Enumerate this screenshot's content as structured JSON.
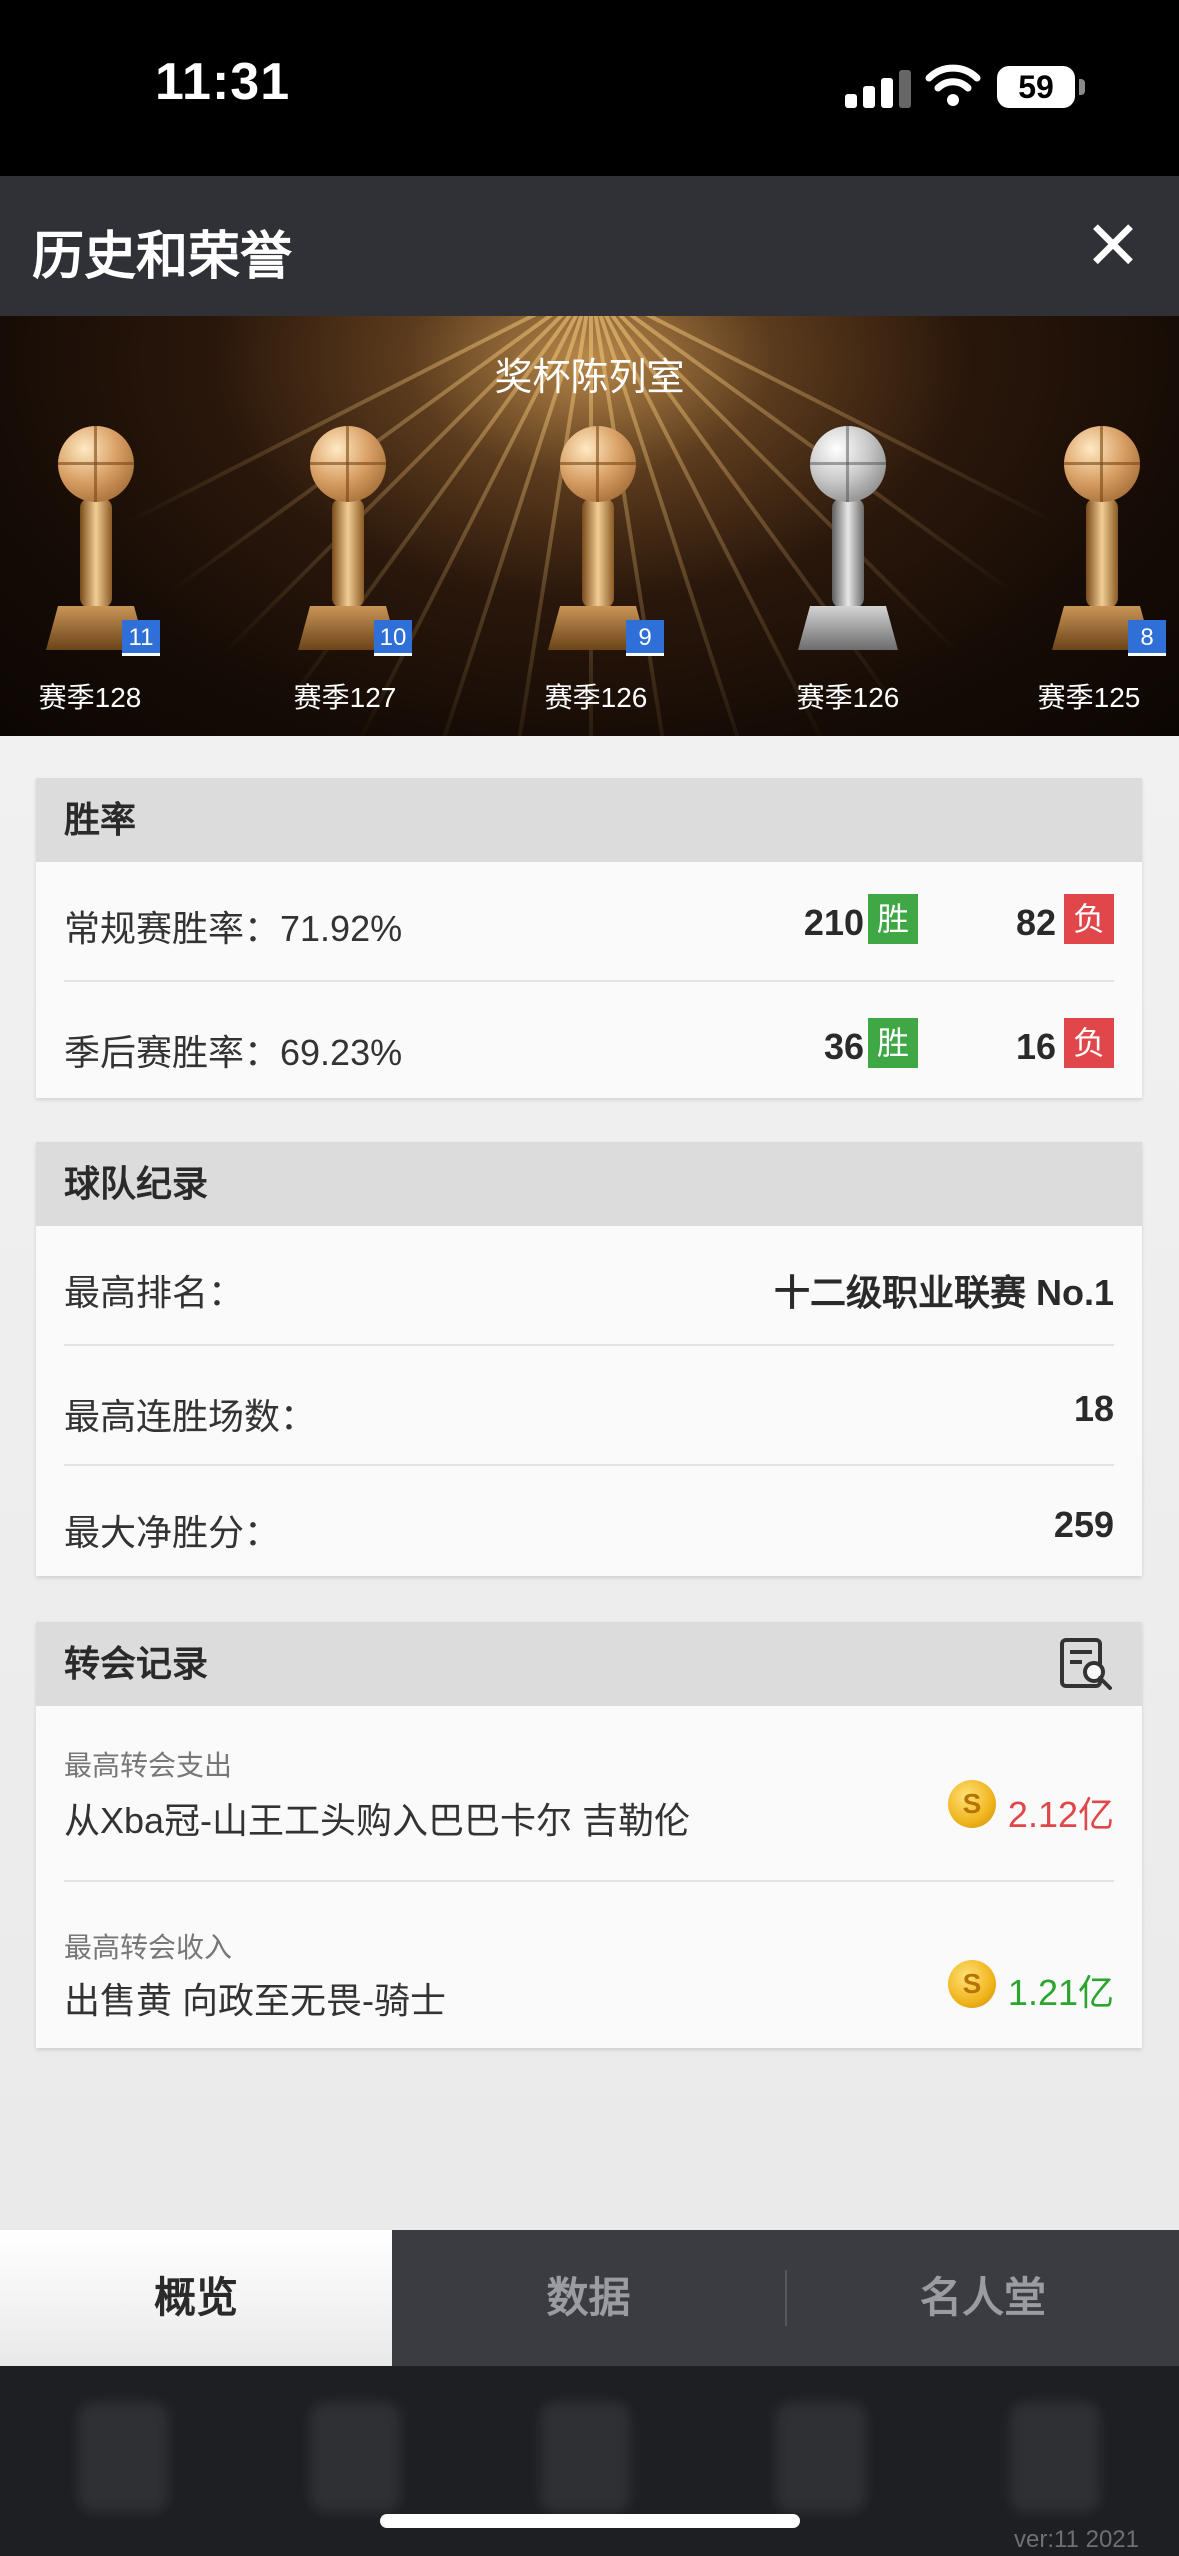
{
  "status": {
    "time": "11:31",
    "battery": "59"
  },
  "header": {
    "title": "历史和荣誉",
    "close_icon": "✕"
  },
  "banner": {
    "title": "奖杯陈列室",
    "trophies": [
      {
        "season": "赛季128",
        "badge": "11",
        "kind": "gold"
      },
      {
        "season": "赛季127",
        "badge": "10",
        "kind": "gold"
      },
      {
        "season": "赛季126",
        "badge": "9",
        "kind": "gold"
      },
      {
        "season": "赛季126",
        "badge": "",
        "kind": "silver"
      },
      {
        "season": "赛季125",
        "badge": "8",
        "kind": "gold"
      }
    ]
  },
  "win_rate": {
    "title": "胜率",
    "regular": {
      "label": "常规赛胜率：71.92%",
      "wins": "210",
      "losses": "82"
    },
    "playoff": {
      "label": "季后赛胜率：69.23%",
      "wins": "36",
      "losses": "16"
    },
    "win_tag": "胜",
    "loss_tag": "负"
  },
  "team_record": {
    "title": "球队纪录",
    "rows": [
      {
        "label": "最高排名：",
        "value": "十二级职业联赛 No.1"
      },
      {
        "label": "最高连胜场数：",
        "value": "18"
      },
      {
        "label": "最大净胜分：",
        "value": "259"
      }
    ]
  },
  "transfer": {
    "title": "转会记录",
    "expense": {
      "caption": "最高转会支出",
      "desc": "从Xba冠-山王工头购入巴巴卡尔 吉勒伦",
      "amount": "2.12亿"
    },
    "income": {
      "caption": "最高转会收入",
      "desc": "出售黄 向政至无畏-骑士",
      "amount": "1.21亿"
    },
    "coin_symbol": "S"
  },
  "tabs": [
    {
      "label": "概览"
    },
    {
      "label": "数据"
    },
    {
      "label": "名人堂"
    }
  ],
  "footer": {
    "version": "ver:11  2021"
  },
  "colors": {
    "win": "#3fa845",
    "loss": "#e0474a",
    "badge": "#2e6fd8"
  }
}
